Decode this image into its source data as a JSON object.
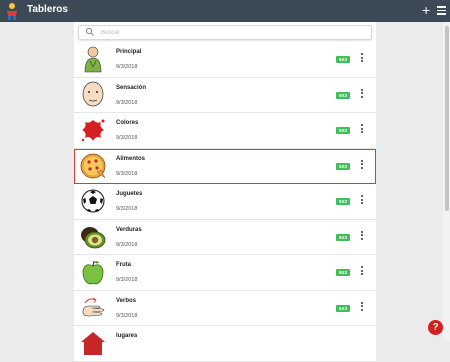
{
  "app": {
    "title": "Tableros"
  },
  "header": {
    "add_label": "+",
    "menu_icon": "hamburger-icon"
  },
  "search": {
    "placeholder": "Buscar",
    "value": ""
  },
  "boards": [
    {
      "name": "Principal",
      "date": "9/3/2018",
      "badge": "5X3",
      "icon": "person-icon"
    },
    {
      "name": "Sensación",
      "date": "9/3/2018",
      "badge": "5X3",
      "icon": "face-icon"
    },
    {
      "name": "Colores",
      "date": "9/3/2018",
      "badge": "5X3",
      "icon": "paint-splash-icon"
    },
    {
      "name": "Alimentos",
      "date": "9/3/2018",
      "badge": "5X3",
      "icon": "pizza-icon",
      "selected": true
    },
    {
      "name": "Juguetes",
      "date": "9/3/2018",
      "badge": "5X3",
      "icon": "soccer-ball-icon"
    },
    {
      "name": "Verduras",
      "date": "9/3/2018",
      "badge": "5X3",
      "icon": "avocado-icon"
    },
    {
      "name": "Fruta",
      "date": "9/3/2018",
      "badge": "5X3",
      "icon": "apple-icon"
    },
    {
      "name": "Verbos",
      "date": "9/3/2018",
      "badge": "5X3",
      "icon": "sign-hands-icon"
    },
    {
      "name": "lugares",
      "date": "",
      "badge": "",
      "icon": "house-icon"
    }
  ],
  "help": {
    "label": "?"
  },
  "colors": {
    "topbar": "#3b4a56",
    "badge": "#3fbf5a",
    "selected_border": "#d83a3a",
    "help": "#d11f1f"
  }
}
